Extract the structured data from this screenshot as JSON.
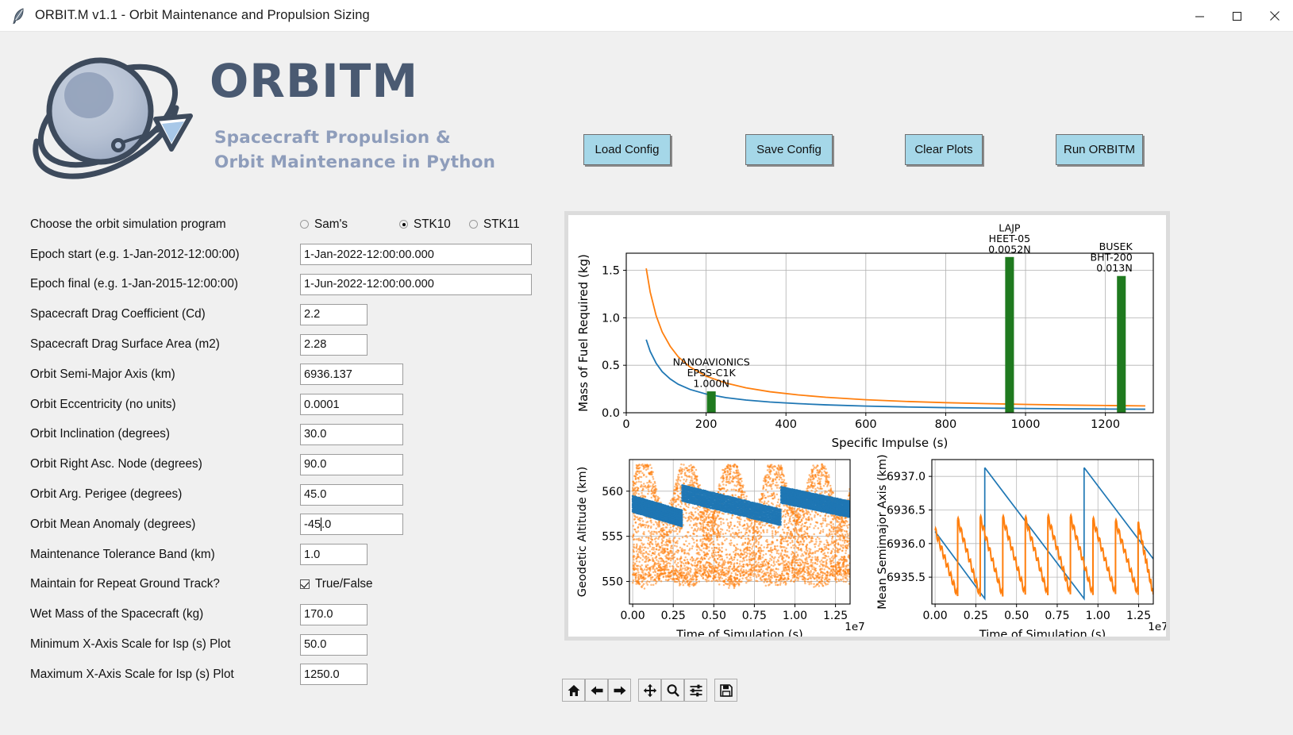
{
  "window": {
    "title": "ORBIT.M v1.1 - Orbit Maintenance and Propulsion Sizing",
    "app_icon": "feather-icon",
    "minimize_label": "—",
    "maximize_label": "□",
    "close_label": "✕"
  },
  "logo": {
    "wordmark": "ORBITM",
    "tagline_line1": "Spacecraft Propulsion &",
    "tagline_line2": "Orbit Maintenance in Python",
    "wordmark_color": "#4a5a72",
    "tagline_color": "#8e9dbb"
  },
  "toolbar": {
    "load_config": "Load Config",
    "save_config": "Save Config",
    "clear_plots": "Clear Plots",
    "run_orbitm": "Run ORBITM",
    "button_color": "#a5d7e8"
  },
  "form": {
    "program": {
      "label": "Choose the orbit simulation program",
      "options": [
        "Sam's",
        "STK10",
        "STK11"
      ],
      "selected": "STK10"
    },
    "fields": [
      {
        "label": "Epoch start (e.g. 1-Jan-2012-12:00:00)",
        "value": "1-Jan-2022-12:00:00.000",
        "width": "wide"
      },
      {
        "label": "Epoch final (e.g. 1-Jan-2015-12:00:00)",
        "value": "1-Jun-2022-12:00:00.000",
        "width": "wide"
      },
      {
        "label": "Spacecraft Drag Coefficient (Cd)",
        "value": "2.2",
        "width": "sm"
      },
      {
        "label": "Spacecraft Drag Surface Area (m2)",
        "value": "2.28",
        "width": "sm"
      },
      {
        "label": "Orbit Semi-Major Axis (km)",
        "value": "6936.137",
        "width": "med"
      },
      {
        "label": "Orbit Eccentricity (no units)",
        "value": "0.0001",
        "width": "med"
      },
      {
        "label": "Orbit Inclination (degrees)",
        "value": "30.0",
        "width": "med"
      },
      {
        "label": "Orbit Right Asc. Node (degrees)",
        "value": "90.0",
        "width": "med"
      },
      {
        "label": "Orbit Arg. Perigee (degrees)",
        "value": "45.0",
        "width": "med"
      },
      {
        "label": "Orbit Mean Anomaly (degrees)",
        "value": "-45.0",
        "width": "med",
        "focused": true
      },
      {
        "label": "Maintenance Tolerance Band (km)",
        "value": "1.0",
        "width": "sm"
      }
    ],
    "repeat_ground_track": {
      "label": "Maintain for Repeat Ground Track?",
      "checkbox_label": "True/False",
      "checked": true
    },
    "fields_after": [
      {
        "label": "Wet Mass of the Spacecraft (kg)",
        "value": "170.0",
        "width": "sm"
      },
      {
        "label": "Minimum X-Axis Scale for Isp (s) Plot",
        "value": "50.0",
        "width": "sm"
      },
      {
        "label": "Maximum X-Axis Scale for Isp (s) Plot",
        "value": "1250.0",
        "width": "sm"
      }
    ]
  },
  "mpl_toolbar": {
    "buttons": [
      {
        "name": "home-icon",
        "tip": "Home"
      },
      {
        "name": "arrow-left-icon",
        "tip": "Back"
      },
      {
        "name": "arrow-right-icon",
        "tip": "Forward"
      },
      {
        "name": "move-icon",
        "tip": "Pan"
      },
      {
        "name": "magnifier-icon",
        "tip": "Zoom"
      },
      {
        "name": "sliders-icon",
        "tip": "Configure subplots"
      },
      {
        "name": "floppy-disk-icon",
        "tip": "Save figure"
      }
    ]
  },
  "chart_data": [
    {
      "id": "isp-fuel-plot",
      "type": "line",
      "title": "",
      "xlabel": "Specific Impulse (s)",
      "ylabel": "Mass of Fuel Required (kg)",
      "xlim": [
        0,
        1320
      ],
      "ylim": [
        0.0,
        1.68
      ],
      "xticks": [
        0,
        200,
        400,
        600,
        800,
        1000,
        1200
      ],
      "yticks": [
        0.0,
        0.5,
        1.0,
        1.5
      ],
      "grid": true,
      "series": [
        {
          "name": "fuel-curve-orange",
          "color": "#ff7f0e",
          "x": [
            50,
            60,
            75,
            90,
            110,
            130,
            160,
            200,
            250,
            300,
            360,
            430,
            500,
            600,
            700,
            800,
            900,
            1000,
            1100,
            1200,
            1300
          ],
          "y": [
            1.52,
            1.27,
            1.02,
            0.85,
            0.7,
            0.59,
            0.48,
            0.385,
            0.312,
            0.262,
            0.221,
            0.188,
            0.163,
            0.137,
            0.119,
            0.106,
            0.096,
            0.088,
            0.081,
            0.076,
            0.072
          ]
        },
        {
          "name": "fuel-curve-blue",
          "color": "#1f77b4",
          "x": [
            50,
            60,
            75,
            90,
            110,
            130,
            160,
            200,
            250,
            300,
            360,
            430,
            500,
            600,
            700,
            800,
            900,
            1000,
            1100,
            1200,
            1300
          ],
          "y": [
            0.77,
            0.645,
            0.52,
            0.432,
            0.356,
            0.3,
            0.245,
            0.197,
            0.159,
            0.134,
            0.113,
            0.096,
            0.083,
            0.07,
            0.061,
            0.054,
            0.049,
            0.045,
            0.042,
            0.039,
            0.037
          ]
        }
      ],
      "bars": [
        {
          "label_lines": [
            "NANOAVIONICS",
            "EPSS-C1K",
            "1.000N"
          ],
          "isp": 213,
          "height": 0.225,
          "color": "#1f7a1f",
          "width_isp": 22
        },
        {
          "label_lines": [
            "LAJP",
            "HEET-05",
            "0.0052N"
          ],
          "isp": 960,
          "height": 1.64,
          "color": "#1f7a1f",
          "width_isp": 22
        },
        {
          "label_lines": [
            "BUSEK",
            "BHT-200",
            "0.013N"
          ],
          "isp": 1240,
          "height": 1.44,
          "color": "#1f7a1f",
          "width_isp": 22
        }
      ]
    },
    {
      "id": "geodetic-altitude-plot",
      "type": "scatter",
      "xlabel": "Time of Simulation (s)",
      "ylabel": "Geodetic Altitude (km)",
      "x_exponent": "1e7",
      "xlim": [
        -0.02,
        1.34
      ],
      "ylim": [
        547.5,
        563.5
      ],
      "xticks": [
        0.0,
        0.25,
        0.5,
        0.75,
        1.0,
        1.25
      ],
      "xticklabels": [
        "0.00",
        "0.25",
        "0.50",
        "0.75",
        "1.00",
        "1.25"
      ],
      "yticks": [
        550,
        555,
        560
      ],
      "grid": true,
      "series": [
        {
          "name": "altitude-orange-scatter",
          "color": "#ff7f0e",
          "description": "dense oscillating scatter cloud, 5 long-period envelopes, band 548-562 km"
        },
        {
          "name": "tolerance-blue-band",
          "color": "#1f77b4",
          "description": "3 descending blue slab segments near 556-560 km, decaying left to right, reset at 0.30 and 0.92"
        }
      ]
    },
    {
      "id": "semimajor-axis-plot",
      "type": "line",
      "xlabel": "Time of Simulation (s)",
      "ylabel": "Mean Semimajor Axis (km)",
      "x_exponent": "1e7",
      "xlim": [
        -0.02,
        1.34
      ],
      "ylim": [
        6935.1,
        6937.25
      ],
      "xticks": [
        0.0,
        0.25,
        0.5,
        0.75,
        1.0,
        1.25
      ],
      "xticklabels": [
        "0.00",
        "0.25",
        "0.50",
        "0.75",
        "1.00",
        "1.25"
      ],
      "yticks": [
        6935.5,
        6936.0,
        6936.5,
        6937.0
      ],
      "grid": true,
      "series": [
        {
          "name": "sma-blue-sawtooth",
          "color": "#1f77b4",
          "description": "large sawtooth: decays from 6937.13 to 6935.18, vertical resets at t=0.305 and t=0.915"
        },
        {
          "name": "sma-orange-sawtooth",
          "color": "#ff7f0e",
          "description": "9 small sawteeth decaying from ~6936.4 to ~6935.25, period ~0.14"
        }
      ]
    }
  ]
}
